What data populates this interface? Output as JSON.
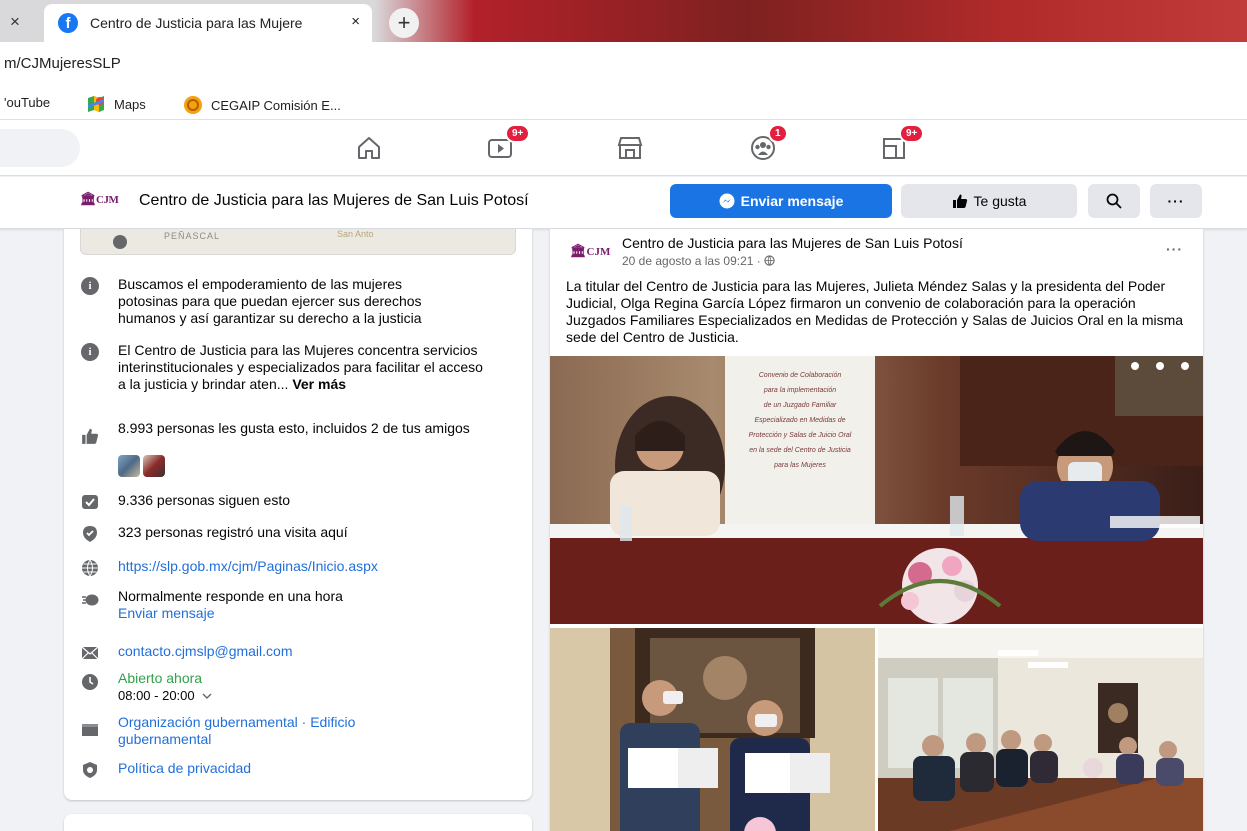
{
  "browser": {
    "tab_title": "Centro de Justicia para las Mujere",
    "tab_close": "×",
    "left_close": "×",
    "new_tab": "+",
    "url": "m/CJMujeresSLP",
    "bookmarks": [
      {
        "label": "'ouTube"
      },
      {
        "label": "Maps"
      },
      {
        "label": "CEGAIP Comisión E..."
      }
    ]
  },
  "fb_nav": {
    "badges": {
      "watch": "9+",
      "groups": "1",
      "gaming": "9+"
    }
  },
  "page_header": {
    "logo_text": "CJM",
    "name": "Centro de Justicia para las Mujeres de San Luis Potosí",
    "message_button": "Enviar mensaje",
    "like_button": "Te gusta",
    "more_button": "···"
  },
  "about": {
    "map_label": "PEÑASCAL",
    "map_label2": "San Anto",
    "items": {
      "mission": "Buscamos el empoderamiento de las mujeres potosinas para que puedan ejercer sus derechos humanos y así garantizar su derecho a la justicia",
      "description": "El Centro de Justicia para las Mujeres concentra servicios interinstitucionales y especializados para facilitar el acceso a la justicia y brindar aten... ",
      "see_more": "Ver más",
      "likes": "8.993 personas les gusta esto, incluidos 2 de tus amigos",
      "followers": "9.336 personas siguen esto",
      "checkins": "323 personas registró una visita aquí",
      "website": "https://slp.gob.mx/cjm/Paginas/Inicio.aspx",
      "response": "Normalmente responde en una hora",
      "send_message": "Enviar mensaje",
      "email": "contacto.cjmslp@gmail.com",
      "open_status": "Abierto ahora",
      "hours": "08:00 - 20:00",
      "category": "Organización gubernamental · Edificio gubernamental",
      "privacy": "Política de privacidad"
    }
  },
  "post": {
    "logo_text": "CJM",
    "author": "Centro de Justicia para las Mujeres de San Luis Potosí",
    "date": "20 de agosto a las 09:21 ·",
    "more": "···",
    "text": "La titular del Centro de Justicia para las Mujeres, Julieta Méndez Salas y la presidenta del Poder Judicial, Olga Regina García López firmaron un convenio de colaboración para la operación Juzgados Familiares Especializados en Medidas de Protección y Salas de Juicios Oral en la misma sede del Centro de Justicia.",
    "banner_lines": [
      "Convenio de Colaboración",
      "para la implementación",
      "de un Juzgado Familiar",
      "Especializado en Medidas de",
      "Protección y Salas de Juicio Oral",
      "en la sede del Centro de Justicia",
      "para las Mujeres"
    ]
  },
  "colors": {
    "fb_blue": "#1b74e4",
    "link": "#216fdb",
    "open_green": "#31a24c",
    "badge_red": "#e41e3f"
  }
}
